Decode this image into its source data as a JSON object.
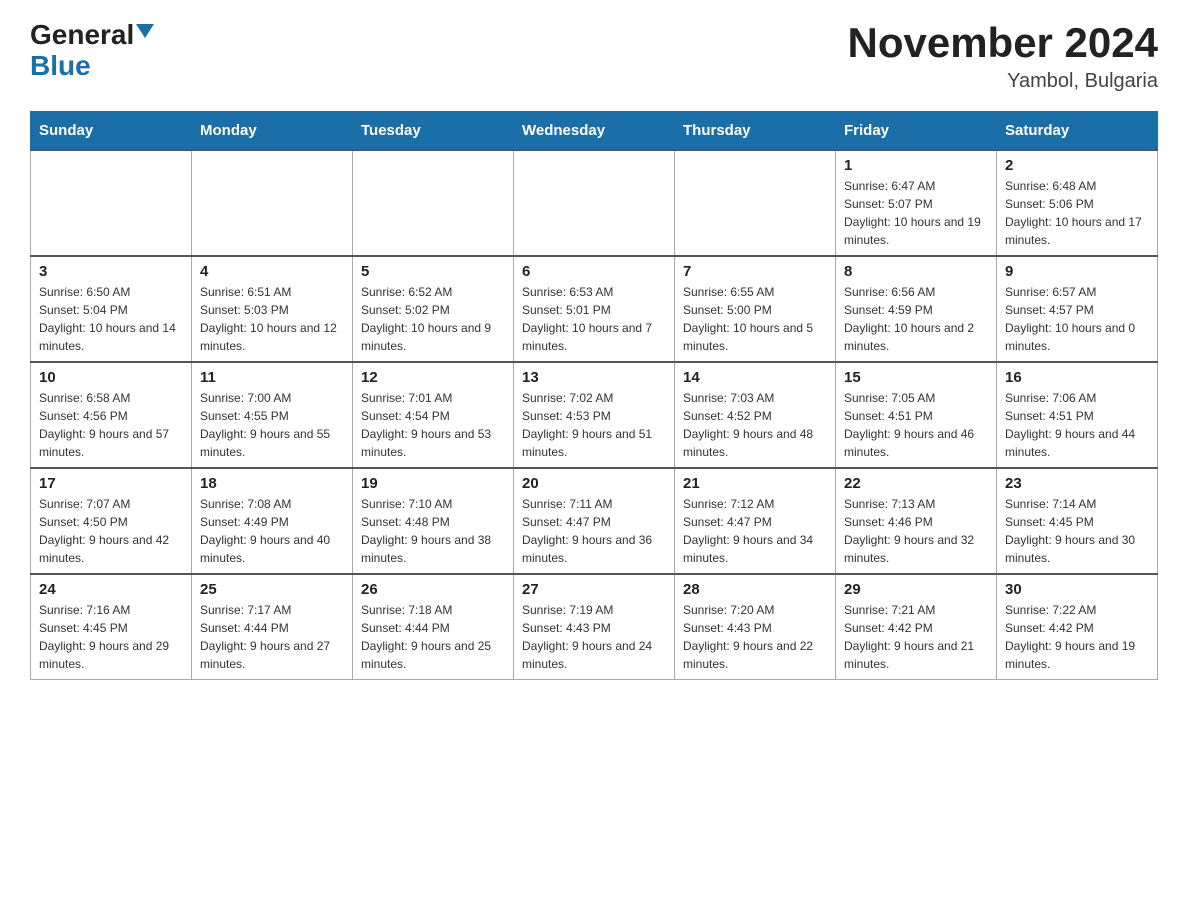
{
  "header": {
    "logo_general": "General",
    "logo_blue": "Blue",
    "title": "November 2024",
    "subtitle": "Yambol, Bulgaria"
  },
  "days_of_week": [
    "Sunday",
    "Monday",
    "Tuesday",
    "Wednesday",
    "Thursday",
    "Friday",
    "Saturday"
  ],
  "weeks": [
    [
      {
        "day": "",
        "sunrise": "",
        "sunset": "",
        "daylight": ""
      },
      {
        "day": "",
        "sunrise": "",
        "sunset": "",
        "daylight": ""
      },
      {
        "day": "",
        "sunrise": "",
        "sunset": "",
        "daylight": ""
      },
      {
        "day": "",
        "sunrise": "",
        "sunset": "",
        "daylight": ""
      },
      {
        "day": "",
        "sunrise": "",
        "sunset": "",
        "daylight": ""
      },
      {
        "day": "1",
        "sunrise": "Sunrise: 6:47 AM",
        "sunset": "Sunset: 5:07 PM",
        "daylight": "Daylight: 10 hours and 19 minutes."
      },
      {
        "day": "2",
        "sunrise": "Sunrise: 6:48 AM",
        "sunset": "Sunset: 5:06 PM",
        "daylight": "Daylight: 10 hours and 17 minutes."
      }
    ],
    [
      {
        "day": "3",
        "sunrise": "Sunrise: 6:50 AM",
        "sunset": "Sunset: 5:04 PM",
        "daylight": "Daylight: 10 hours and 14 minutes."
      },
      {
        "day": "4",
        "sunrise": "Sunrise: 6:51 AM",
        "sunset": "Sunset: 5:03 PM",
        "daylight": "Daylight: 10 hours and 12 minutes."
      },
      {
        "day": "5",
        "sunrise": "Sunrise: 6:52 AM",
        "sunset": "Sunset: 5:02 PM",
        "daylight": "Daylight: 10 hours and 9 minutes."
      },
      {
        "day": "6",
        "sunrise": "Sunrise: 6:53 AM",
        "sunset": "Sunset: 5:01 PM",
        "daylight": "Daylight: 10 hours and 7 minutes."
      },
      {
        "day": "7",
        "sunrise": "Sunrise: 6:55 AM",
        "sunset": "Sunset: 5:00 PM",
        "daylight": "Daylight: 10 hours and 5 minutes."
      },
      {
        "day": "8",
        "sunrise": "Sunrise: 6:56 AM",
        "sunset": "Sunset: 4:59 PM",
        "daylight": "Daylight: 10 hours and 2 minutes."
      },
      {
        "day": "9",
        "sunrise": "Sunrise: 6:57 AM",
        "sunset": "Sunset: 4:57 PM",
        "daylight": "Daylight: 10 hours and 0 minutes."
      }
    ],
    [
      {
        "day": "10",
        "sunrise": "Sunrise: 6:58 AM",
        "sunset": "Sunset: 4:56 PM",
        "daylight": "Daylight: 9 hours and 57 minutes."
      },
      {
        "day": "11",
        "sunrise": "Sunrise: 7:00 AM",
        "sunset": "Sunset: 4:55 PM",
        "daylight": "Daylight: 9 hours and 55 minutes."
      },
      {
        "day": "12",
        "sunrise": "Sunrise: 7:01 AM",
        "sunset": "Sunset: 4:54 PM",
        "daylight": "Daylight: 9 hours and 53 minutes."
      },
      {
        "day": "13",
        "sunrise": "Sunrise: 7:02 AM",
        "sunset": "Sunset: 4:53 PM",
        "daylight": "Daylight: 9 hours and 51 minutes."
      },
      {
        "day": "14",
        "sunrise": "Sunrise: 7:03 AM",
        "sunset": "Sunset: 4:52 PM",
        "daylight": "Daylight: 9 hours and 48 minutes."
      },
      {
        "day": "15",
        "sunrise": "Sunrise: 7:05 AM",
        "sunset": "Sunset: 4:51 PM",
        "daylight": "Daylight: 9 hours and 46 minutes."
      },
      {
        "day": "16",
        "sunrise": "Sunrise: 7:06 AM",
        "sunset": "Sunset: 4:51 PM",
        "daylight": "Daylight: 9 hours and 44 minutes."
      }
    ],
    [
      {
        "day": "17",
        "sunrise": "Sunrise: 7:07 AM",
        "sunset": "Sunset: 4:50 PM",
        "daylight": "Daylight: 9 hours and 42 minutes."
      },
      {
        "day": "18",
        "sunrise": "Sunrise: 7:08 AM",
        "sunset": "Sunset: 4:49 PM",
        "daylight": "Daylight: 9 hours and 40 minutes."
      },
      {
        "day": "19",
        "sunrise": "Sunrise: 7:10 AM",
        "sunset": "Sunset: 4:48 PM",
        "daylight": "Daylight: 9 hours and 38 minutes."
      },
      {
        "day": "20",
        "sunrise": "Sunrise: 7:11 AM",
        "sunset": "Sunset: 4:47 PM",
        "daylight": "Daylight: 9 hours and 36 minutes."
      },
      {
        "day": "21",
        "sunrise": "Sunrise: 7:12 AM",
        "sunset": "Sunset: 4:47 PM",
        "daylight": "Daylight: 9 hours and 34 minutes."
      },
      {
        "day": "22",
        "sunrise": "Sunrise: 7:13 AM",
        "sunset": "Sunset: 4:46 PM",
        "daylight": "Daylight: 9 hours and 32 minutes."
      },
      {
        "day": "23",
        "sunrise": "Sunrise: 7:14 AM",
        "sunset": "Sunset: 4:45 PM",
        "daylight": "Daylight: 9 hours and 30 minutes."
      }
    ],
    [
      {
        "day": "24",
        "sunrise": "Sunrise: 7:16 AM",
        "sunset": "Sunset: 4:45 PM",
        "daylight": "Daylight: 9 hours and 29 minutes."
      },
      {
        "day": "25",
        "sunrise": "Sunrise: 7:17 AM",
        "sunset": "Sunset: 4:44 PM",
        "daylight": "Daylight: 9 hours and 27 minutes."
      },
      {
        "day": "26",
        "sunrise": "Sunrise: 7:18 AM",
        "sunset": "Sunset: 4:44 PM",
        "daylight": "Daylight: 9 hours and 25 minutes."
      },
      {
        "day": "27",
        "sunrise": "Sunrise: 7:19 AM",
        "sunset": "Sunset: 4:43 PM",
        "daylight": "Daylight: 9 hours and 24 minutes."
      },
      {
        "day": "28",
        "sunrise": "Sunrise: 7:20 AM",
        "sunset": "Sunset: 4:43 PM",
        "daylight": "Daylight: 9 hours and 22 minutes."
      },
      {
        "day": "29",
        "sunrise": "Sunrise: 7:21 AM",
        "sunset": "Sunset: 4:42 PM",
        "daylight": "Daylight: 9 hours and 21 minutes."
      },
      {
        "day": "30",
        "sunrise": "Sunrise: 7:22 AM",
        "sunset": "Sunset: 4:42 PM",
        "daylight": "Daylight: 9 hours and 19 minutes."
      }
    ]
  ]
}
